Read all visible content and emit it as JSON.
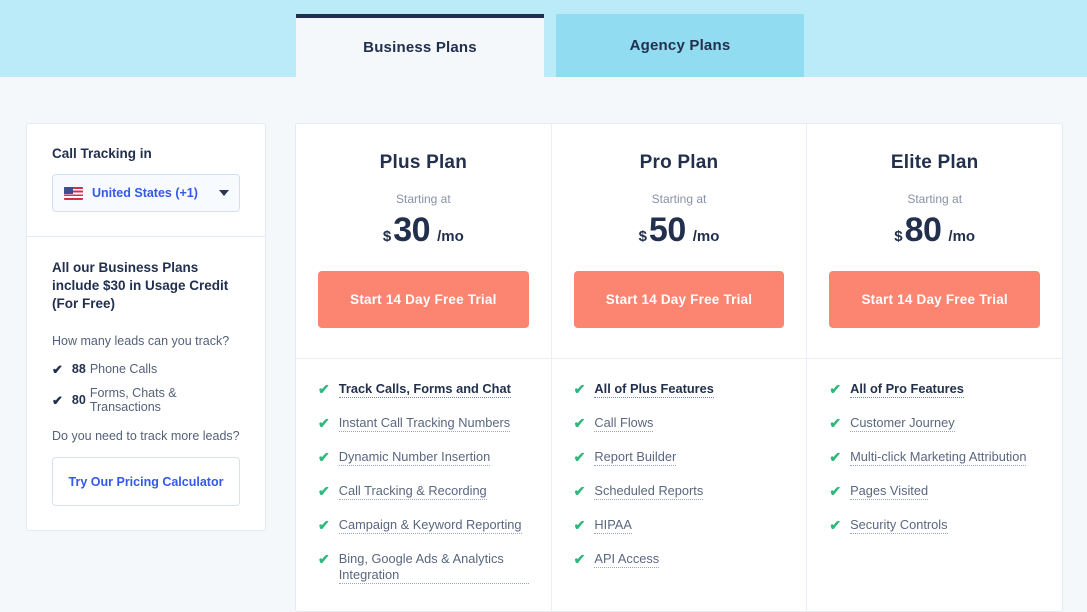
{
  "tabs": [
    {
      "label": "Business Plans",
      "active": true
    },
    {
      "label": "Agency Plans",
      "active": false
    }
  ],
  "sidebar": {
    "call_tracking_title": "Call Tracking in",
    "country": {
      "name": "United States (+1)",
      "flag_icon": "us-flag-icon",
      "caret_icon": "chevron-down-icon"
    },
    "headline": "All our Business Plans include $30 in Usage Credit (For Free)",
    "leads_question": "How many leads can you track?",
    "leads": [
      {
        "count": "88",
        "label": "Phone Calls"
      },
      {
        "count": "80",
        "label": "Forms, Chats & Transactions"
      }
    ],
    "more_leads_question": "Do you need to track more leads?",
    "calculator_button": "Try Our Pricing Calculator"
  },
  "plans": [
    {
      "name": "Plus Plan",
      "starting_at": "Starting at",
      "currency": "$",
      "amount": "30",
      "period": "/mo",
      "cta": "Start 14 Day Free Trial",
      "features": [
        {
          "label": "Track Calls, Forms and Chat",
          "bold": true
        },
        {
          "label": "Instant Call Tracking Numbers",
          "bold": false
        },
        {
          "label": "Dynamic Number Insertion",
          "bold": false
        },
        {
          "label": "Call Tracking & Recording",
          "bold": false
        },
        {
          "label": "Campaign & Keyword Reporting",
          "bold": false
        },
        {
          "label": "Bing, Google Ads & Analytics Integration",
          "bold": false
        }
      ]
    },
    {
      "name": "Pro Plan",
      "starting_at": "Starting at",
      "currency": "$",
      "amount": "50",
      "period": "/mo",
      "cta": "Start 14 Day Free Trial",
      "features": [
        {
          "label": "All of Plus Features",
          "bold": true
        },
        {
          "label": "Call Flows",
          "bold": false
        },
        {
          "label": "Report Builder",
          "bold": false
        },
        {
          "label": "Scheduled Reports",
          "bold": false
        },
        {
          "label": "HIPAA",
          "bold": false
        },
        {
          "label": "API Access",
          "bold": false
        }
      ]
    },
    {
      "name": "Elite Plan",
      "starting_at": "Starting at",
      "currency": "$",
      "amount": "80",
      "period": "/mo",
      "cta": "Start 14 Day Free Trial",
      "features": [
        {
          "label": "All of Pro Features",
          "bold": true
        },
        {
          "label": "Customer Journey",
          "bold": false
        },
        {
          "label": "Multi-click Marketing Attribution",
          "bold": false
        },
        {
          "label": "Pages Visited",
          "bold": false
        },
        {
          "label": "Security Controls",
          "bold": false
        }
      ]
    }
  ],
  "icons": {
    "check": "✔",
    "feature_check": "✔"
  },
  "colors": {
    "band": "#bbeaf9",
    "tab_inactive": "#91dcf0",
    "tab_active_border": "#22304e",
    "page_bg": "#f5f8fb",
    "cta": "#fb8570",
    "link_blue": "#3558e8",
    "check_green": "#2eb87e"
  }
}
